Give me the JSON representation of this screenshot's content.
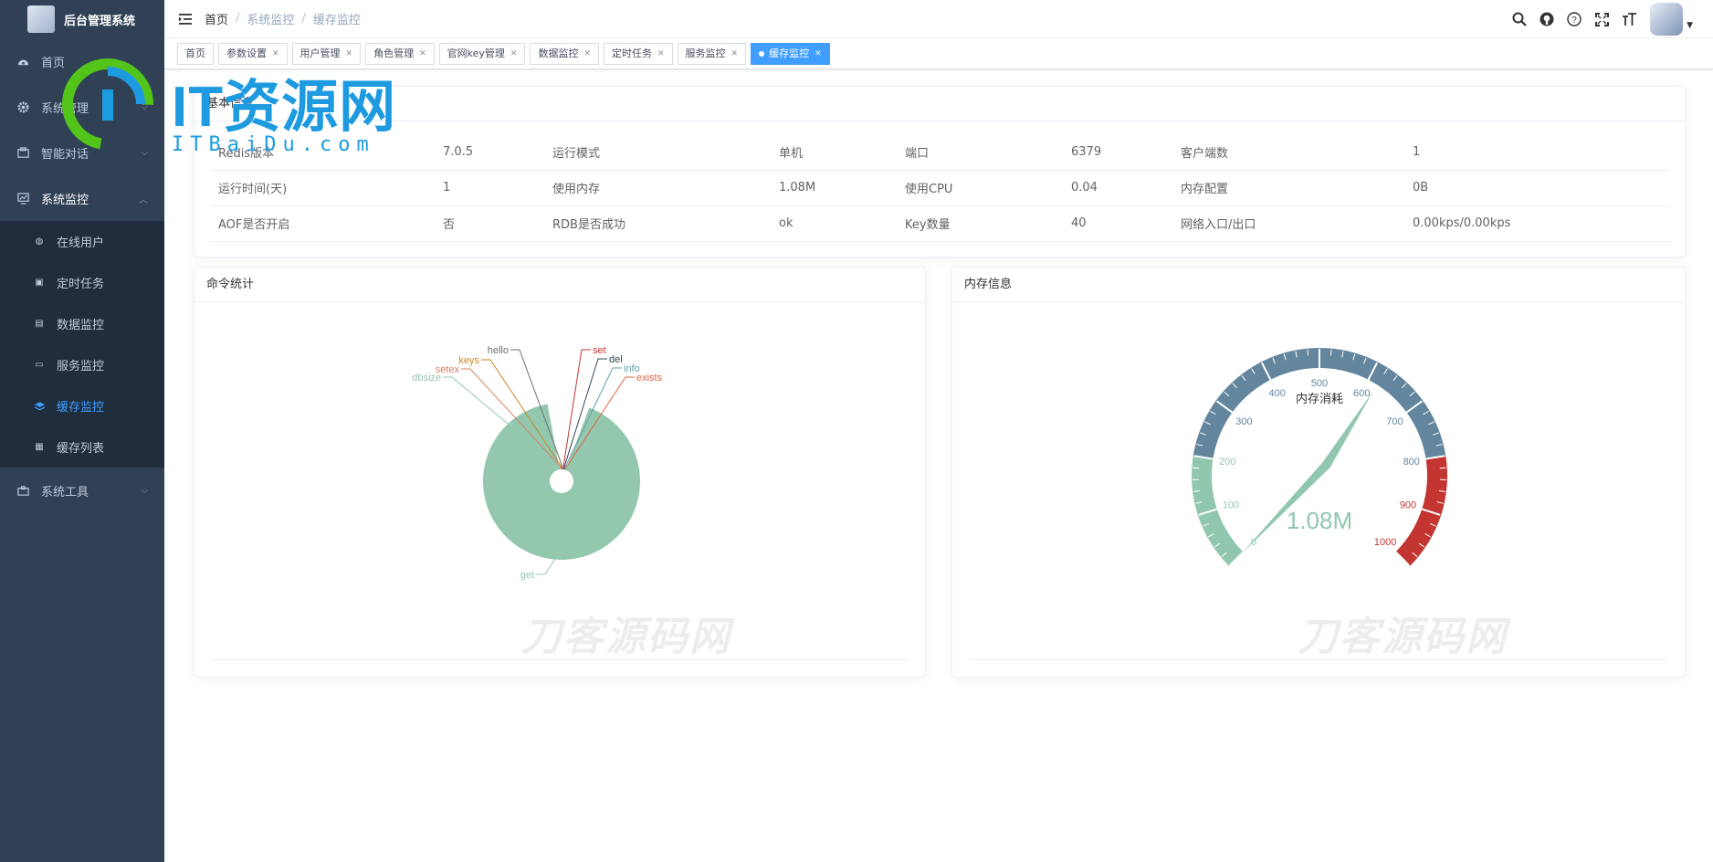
{
  "app": {
    "title": "后台管理系统"
  },
  "sidebar": {
    "items": [
      {
        "label": "首页",
        "icon": "dashboard-icon"
      },
      {
        "label": "系统管理",
        "icon": "gear-icon"
      },
      {
        "label": "智能对话",
        "icon": "chat-icon"
      },
      {
        "label": "系统监控",
        "icon": "monitor-icon"
      },
      {
        "label": "系统工具",
        "icon": "tool-icon"
      }
    ],
    "submenu": [
      {
        "label": "在线用户",
        "icon": "online-icon"
      },
      {
        "label": "定时任务",
        "icon": "job-icon"
      },
      {
        "label": "数据监控",
        "icon": "druid-icon"
      },
      {
        "label": "服务监控",
        "icon": "server-icon"
      },
      {
        "label": "缓存监控",
        "icon": "redis-icon",
        "active": true
      },
      {
        "label": "缓存列表",
        "icon": "redis-list-icon"
      }
    ]
  },
  "navbar": {
    "breadcrumb": [
      "首页",
      "/",
      "系统监控",
      "/",
      "缓存监控"
    ],
    "icons": [
      "search-icon",
      "github-icon",
      "question-icon",
      "fullscreen-icon",
      "font-size-icon"
    ]
  },
  "tags": [
    {
      "label": "首页",
      "closable": false
    },
    {
      "label": "参数设置",
      "closable": true
    },
    {
      "label": "用户管理",
      "closable": true
    },
    {
      "label": "角色管理",
      "closable": true
    },
    {
      "label": "官网key管理",
      "closable": true
    },
    {
      "label": "数据监控",
      "closable": true
    },
    {
      "label": "定时任务",
      "closable": true
    },
    {
      "label": "服务监控",
      "closable": true
    },
    {
      "label": "缓存监控",
      "closable": true,
      "active": true
    }
  ],
  "basic_info": {
    "title": "基本信息",
    "rows": [
      [
        "Redis版本",
        "7.0.5",
        "运行模式",
        "单机",
        "端口",
        "6379",
        "客户端数",
        "1"
      ],
      [
        "运行时间(天)",
        "1",
        "使用内存",
        "1.08M",
        "使用CPU",
        "0.04",
        "内存配置",
        "0B"
      ],
      [
        "AOF是否开启",
        "否",
        "RDB是否成功",
        "ok",
        "Key数量",
        "40",
        "网络入口/出口",
        "0.00kps/0.00kps"
      ]
    ]
  },
  "command_stats": {
    "title": "命令统计"
  },
  "memory_info": {
    "title": "内存信息"
  },
  "watermark": {
    "text": "刀客源码网",
    "logo_text": "IT资源网",
    "logo_sub": "ITBaiDu.com"
  },
  "chart_data": [
    {
      "type": "pie",
      "title": "命令统计",
      "rose": true,
      "categories": [
        "get",
        "dbsize",
        "setex",
        "keys",
        "hello",
        "set",
        "del",
        "info",
        "exists"
      ],
      "values": [
        85,
        1,
        1,
        1,
        1,
        1,
        1,
        1,
        1
      ],
      "colors": [
        "#93c8ae",
        "#91c7ae",
        "#d48265",
        "#ca8622",
        "#6e7074",
        "#c23531",
        "#2f4554",
        "#61a0a8",
        "#e06343"
      ]
    },
    {
      "type": "gauge",
      "title": "内存消耗",
      "value": 1.08,
      "value_label": "1.08M",
      "min": 0,
      "max": 1000,
      "ticks": [
        "0",
        "100",
        "200",
        "300",
        "400",
        "500",
        "600",
        "700",
        "800",
        "900",
        "1000"
      ],
      "bands": [
        {
          "to": 0.2,
          "color": "#91c7ae"
        },
        {
          "to": 0.8,
          "color": "#63869e"
        },
        {
          "to": 1.0,
          "color": "#c23531"
        }
      ]
    }
  ]
}
